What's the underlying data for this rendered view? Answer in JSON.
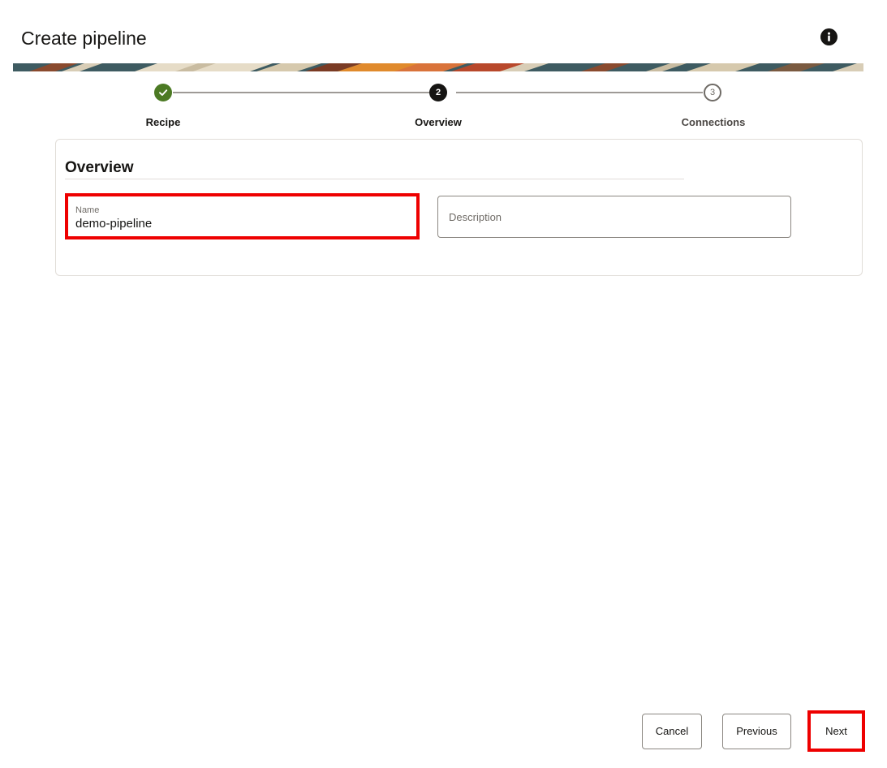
{
  "header": {
    "title": "Create pipeline",
    "info_icon": "info-icon"
  },
  "stepper": {
    "steps": [
      {
        "number": "",
        "label": "Recipe",
        "status": "completed",
        "icon": "check-icon"
      },
      {
        "number": "2",
        "label": "Overview",
        "status": "current"
      },
      {
        "number": "3",
        "label": "Connections",
        "status": "pending"
      }
    ]
  },
  "overview": {
    "section_title": "Overview",
    "name_field": {
      "label": "Name",
      "value": "demo-pipeline"
    },
    "description_field": {
      "placeholder": "Description",
      "value": ""
    }
  },
  "footer": {
    "cancel_label": "Cancel",
    "previous_label": "Previous",
    "next_label": "Next"
  },
  "colors": {
    "completed_step": "#4c7a24",
    "current_step": "#161513",
    "highlight": "#ee0000"
  }
}
